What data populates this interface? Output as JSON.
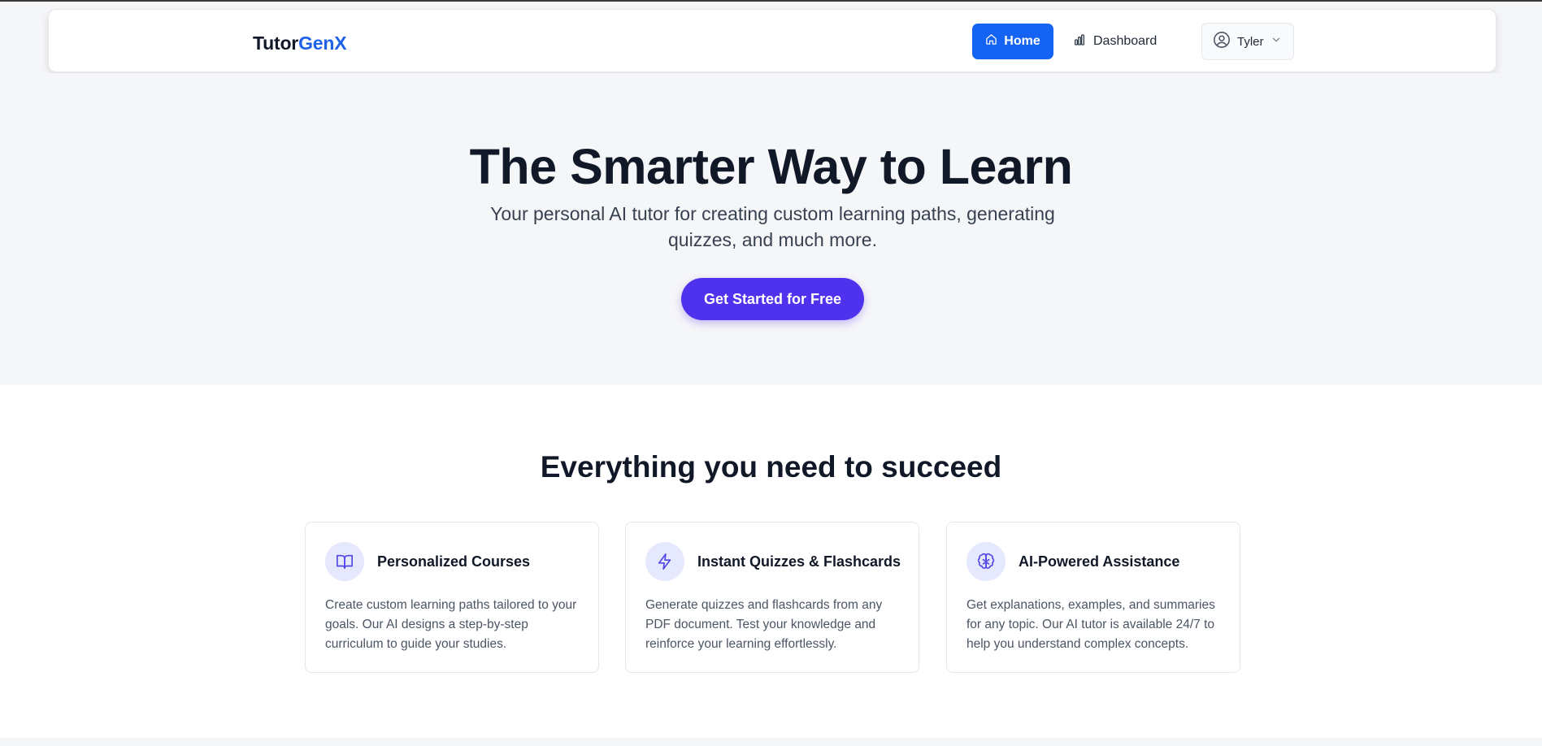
{
  "nav": {
    "brand_main": "Tutor",
    "brand_accent": "GenX",
    "home_label": "Home",
    "dashboard_label": "Dashboard",
    "user_name": "Tyler"
  },
  "hero": {
    "title": "The Smarter Way to Learn",
    "subtitle": "Your personal AI tutor for creating custom learning paths, generating quizzes, and much more.",
    "cta_label": "Get Started for Free"
  },
  "features": {
    "heading": "Everything you need to succeed",
    "cards": [
      {
        "icon": "book-open-icon",
        "title": "Personalized Courses",
        "description": "Create custom learning paths tailored to your goals. Our AI designs a step-by-step curriculum to guide your studies."
      },
      {
        "icon": "lightning-icon",
        "title": "Instant Quizzes & Flashcards",
        "description": "Generate quizzes and flashcards from any PDF document. Test your knowledge and reinforce your learning effortlessly."
      },
      {
        "icon": "brain-icon",
        "title": "AI-Powered Assistance",
        "description": "Get explanations, examples, and summaries for any topic. Our AI tutor is available 24/7 to help you understand complex concepts."
      }
    ]
  },
  "colors": {
    "brand_accent": "#1e62ea",
    "home_button": "#1463f3",
    "cta_button": "#4f32ee",
    "icon_bg": "#e6e8fd",
    "icon_stroke": "#4f46e5"
  }
}
